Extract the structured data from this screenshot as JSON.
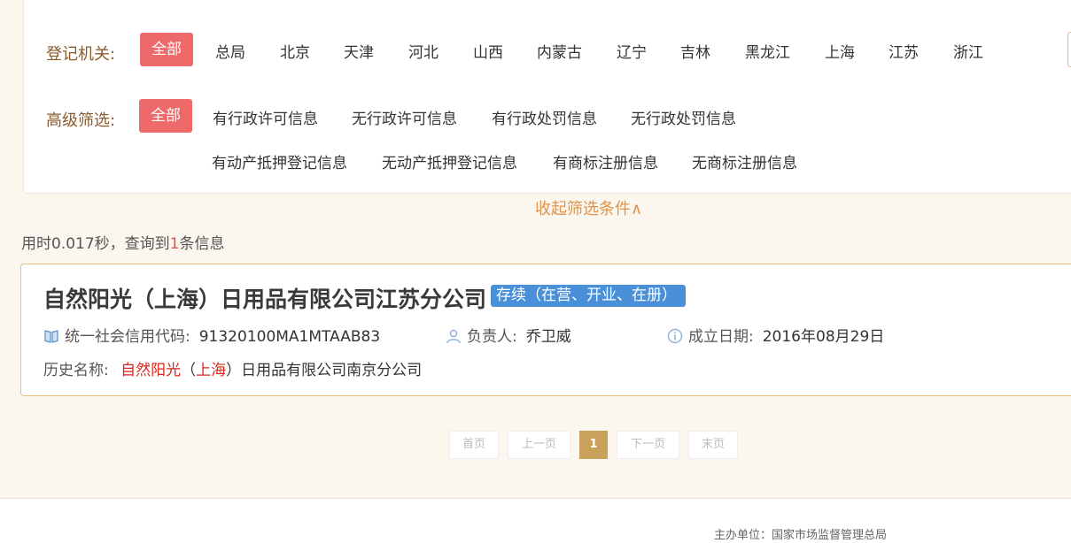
{
  "filters": {
    "registration": {
      "label": "登记机关:",
      "options": [
        "全部",
        "总局",
        "北京",
        "天津",
        "河北",
        "山西",
        "内蒙古",
        "辽宁",
        "吉林",
        "黑龙江",
        "上海",
        "江苏",
        "浙江"
      ],
      "selected": "全部"
    },
    "advanced": {
      "label": "高级筛选:",
      "all": "全部",
      "row1": [
        "有行政许可信息",
        "无行政许可信息",
        "有行政处罚信息",
        "无行政处罚信息"
      ],
      "row2": [
        "有动产抵押登记信息",
        "无动产抵押登记信息",
        "有商标注册信息",
        "无商标注册信息"
      ],
      "selected": "全部"
    },
    "collapse_label": "收起筛选条件∧"
  },
  "stats": {
    "prefix": "用时",
    "time": "0.017",
    "mid": "秒，查询到",
    "count": "1",
    "suffix": "条信息"
  },
  "result": {
    "name": "自然阳光（上海）日用品有限公司江苏分公司",
    "status": "存续（在营、开业、在册）",
    "credit_code_label": "统一社会信用代码:",
    "credit_code": "91320100MA1MTAAB83",
    "person_label": "负责人:",
    "person": "乔卫威",
    "date_label": "成立日期:",
    "date": "2016年08月29日",
    "history_label": "历史名称:",
    "history_highlight_1": "自然阳光",
    "history_paren_open": "（",
    "history_highlight_2": "上海",
    "history_paren_close": "）",
    "history_rest": "日用品有限公司南京分公司"
  },
  "pagination": {
    "first": "首页",
    "prev": "上一页",
    "current": "1",
    "next": "下一页",
    "last": "末页"
  },
  "footer": {
    "sponsor": "主办单位：国家市场监督管理总局"
  },
  "colors": {
    "active_chip": "#ee6a6a",
    "status_badge": "#4a90d9",
    "pager_current": "#c9a15a",
    "highlight_red": "#d9261c"
  }
}
